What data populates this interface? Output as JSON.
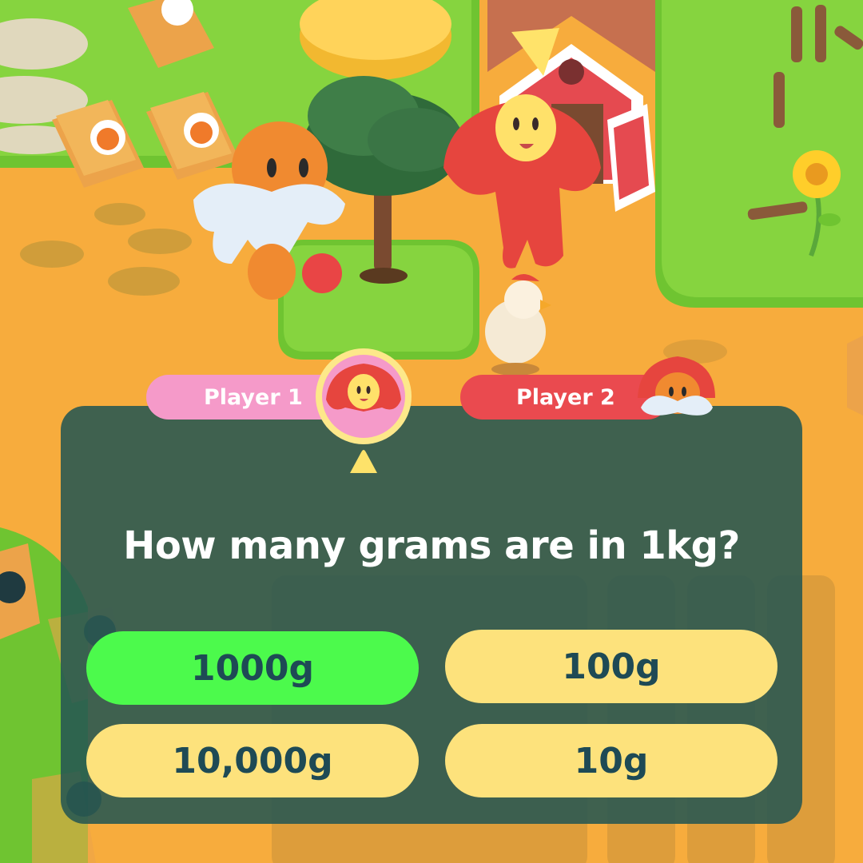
{
  "players": [
    {
      "label": "Player 1"
    },
    {
      "label": "Player 2"
    }
  ],
  "question": "How many grams are in 1kg?",
  "answers": [
    {
      "label": "1000g",
      "state": "correct"
    },
    {
      "label": "100g",
      "state": "normal"
    },
    {
      "label": "10,000g",
      "state": "normal"
    },
    {
      "label": "10g",
      "state": "normal"
    }
  ],
  "colors": {
    "ground": "#f7ac3d",
    "grass": "#82d23c",
    "panel": "#265652",
    "correct": "#4cfa4c",
    "answer": "#fde27c",
    "answer_text": "#1e4a55",
    "player1": "#f59ac9",
    "player2": "#ea4a4f"
  }
}
